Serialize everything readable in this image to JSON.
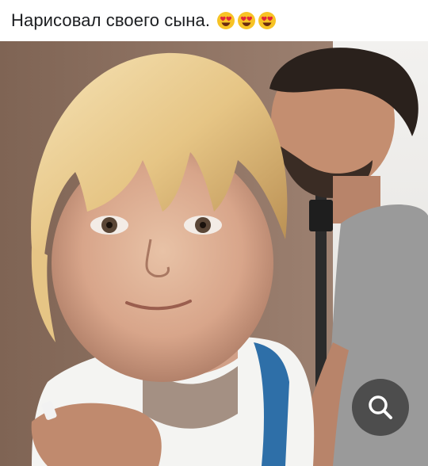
{
  "post": {
    "caption": "Нарисовал своего сына.",
    "emojis": [
      "heart-eyes-emoji",
      "heart-eyes-emoji",
      "heart-eyes-emoji"
    ]
  },
  "photo": {
    "subject": "photo"
  },
  "controls": {
    "search_icon": "search-icon",
    "accent_color": "#3c3c3c"
  }
}
